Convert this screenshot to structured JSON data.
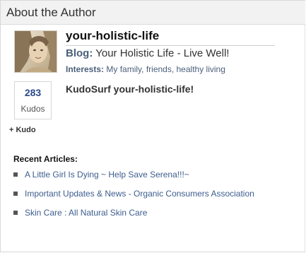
{
  "section": {
    "title": "About the Author"
  },
  "author": {
    "username": "your-holistic-life",
    "blog_label": "Blog:",
    "blog_title": "Your Holistic Life - Live Well!",
    "interests_label": "Interests:",
    "interests": "My family, friends, healthy living"
  },
  "kudos": {
    "count": "283",
    "label": "Kudos",
    "add_label": "+ Kudo",
    "kudosurf_label": "KudoSurf your-holistic-life!"
  },
  "recent": {
    "heading": "Recent Articles:",
    "articles": [
      {
        "title": "A Little Girl Is Dying ~ Help Save Serena!!!~"
      },
      {
        "title": "Important Updates & News - Organic Consumers Association"
      },
      {
        "title": "Skin Care : All Natural Skin Care"
      }
    ]
  },
  "colors": {
    "link": "#3d5d8e",
    "blog_title": "#b0302a",
    "add_kudo": "#e05a10",
    "header_bg": "#f2f2f2"
  },
  "icons": {
    "bullet": "square-bullet-icon"
  }
}
